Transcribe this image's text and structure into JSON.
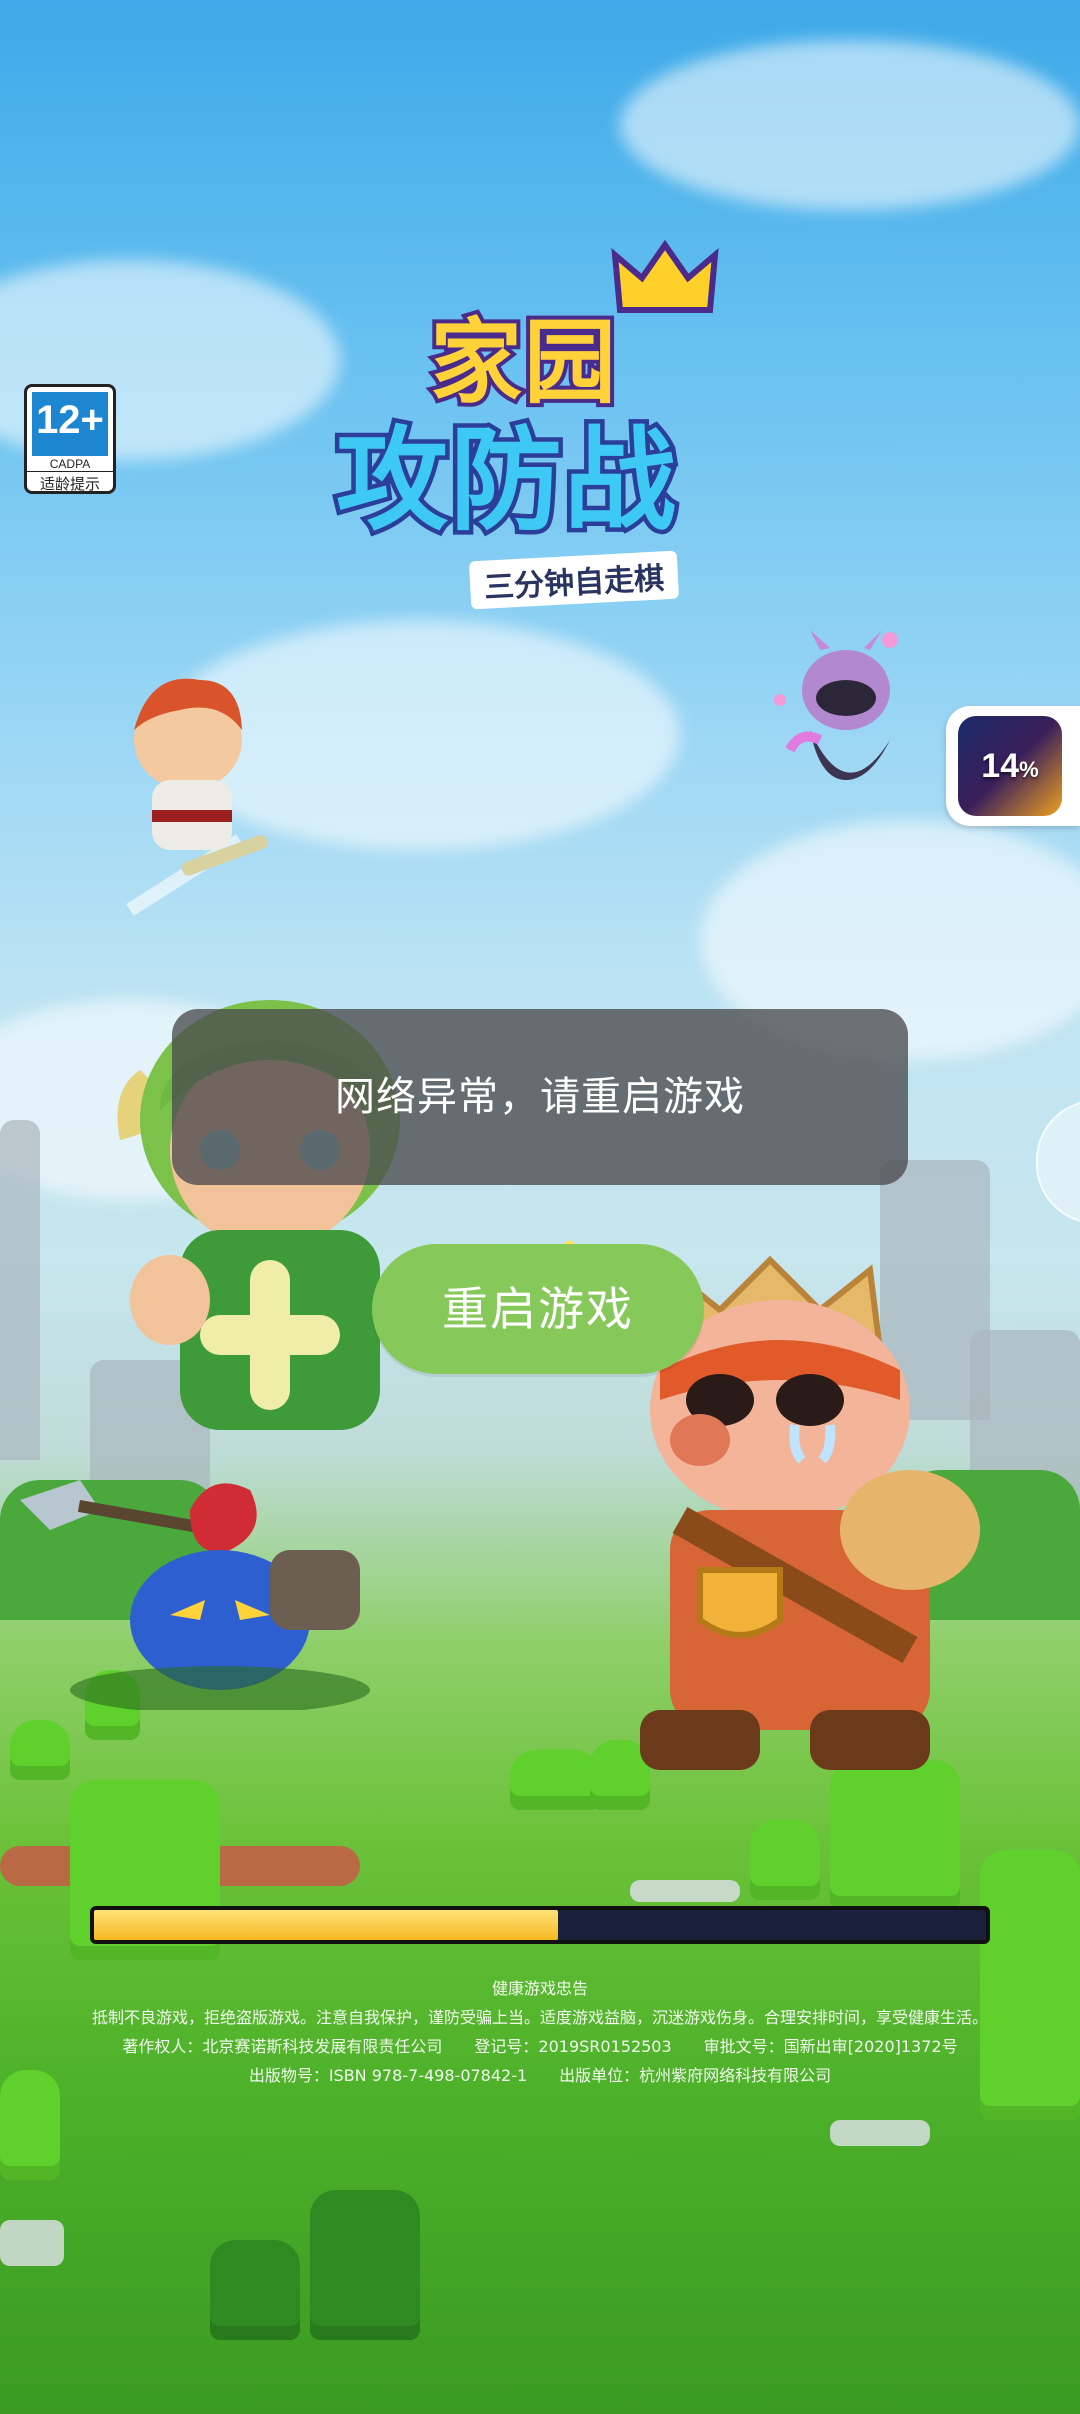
{
  "age_badge": {
    "rating": "12+",
    "org": "CADPA",
    "tip": "适龄提示"
  },
  "logo": {
    "line1": "家园",
    "line2": "攻防战",
    "subtitle": "三分钟自走棋"
  },
  "download_chip": {
    "percent": "14",
    "unit": "%"
  },
  "toast": {
    "message": "网络异常，请重启游戏"
  },
  "restart_button": {
    "label": "重启游戏"
  },
  "loading": {
    "progress": 0.52
  },
  "notice": {
    "title": "健康游戏忠告",
    "line1": "抵制不良游戏，拒绝盗版游戏。注意自我保护，谨防受骗上当。适度游戏益脑，沉迷游戏伤身。合理安排时间，享受健康生活。",
    "line2": "著作权人：北京赛诺斯科技发展有限责任公司　　登记号：2019SR0152503　　审批文号：国新出审[2020]1372号",
    "line3": "出版物号：ISBN 978-7-498-07842-1　　出版单位：杭州紫府网络科技有限公司"
  },
  "colors": {
    "button": "#86c95a",
    "bar_fill": "#f6b81f",
    "bar_track": "#1a1f3a"
  }
}
